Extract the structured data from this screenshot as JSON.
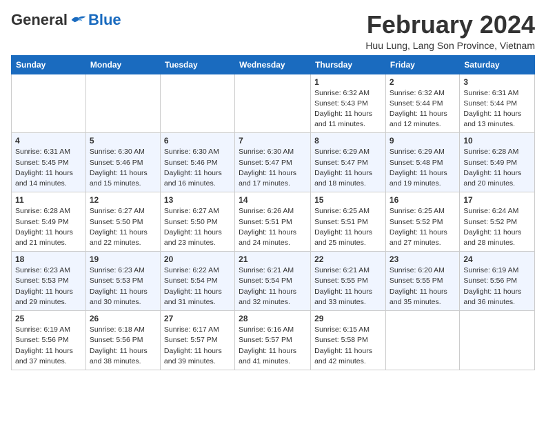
{
  "logo": {
    "general": "General",
    "blue": "Blue"
  },
  "title": "February 2024",
  "subtitle": "Huu Lung, Lang Son Province, Vietnam",
  "days_of_week": [
    "Sunday",
    "Monday",
    "Tuesday",
    "Wednesday",
    "Thursday",
    "Friday",
    "Saturday"
  ],
  "weeks": [
    [
      {
        "day": "",
        "info": ""
      },
      {
        "day": "",
        "info": ""
      },
      {
        "day": "",
        "info": ""
      },
      {
        "day": "",
        "info": ""
      },
      {
        "day": "1",
        "info": "Sunrise: 6:32 AM\nSunset: 5:43 PM\nDaylight: 11 hours and 11 minutes."
      },
      {
        "day": "2",
        "info": "Sunrise: 6:32 AM\nSunset: 5:44 PM\nDaylight: 11 hours and 12 minutes."
      },
      {
        "day": "3",
        "info": "Sunrise: 6:31 AM\nSunset: 5:44 PM\nDaylight: 11 hours and 13 minutes."
      }
    ],
    [
      {
        "day": "4",
        "info": "Sunrise: 6:31 AM\nSunset: 5:45 PM\nDaylight: 11 hours and 14 minutes."
      },
      {
        "day": "5",
        "info": "Sunrise: 6:30 AM\nSunset: 5:46 PM\nDaylight: 11 hours and 15 minutes."
      },
      {
        "day": "6",
        "info": "Sunrise: 6:30 AM\nSunset: 5:46 PM\nDaylight: 11 hours and 16 minutes."
      },
      {
        "day": "7",
        "info": "Sunrise: 6:30 AM\nSunset: 5:47 PM\nDaylight: 11 hours and 17 minutes."
      },
      {
        "day": "8",
        "info": "Sunrise: 6:29 AM\nSunset: 5:47 PM\nDaylight: 11 hours and 18 minutes."
      },
      {
        "day": "9",
        "info": "Sunrise: 6:29 AM\nSunset: 5:48 PM\nDaylight: 11 hours and 19 minutes."
      },
      {
        "day": "10",
        "info": "Sunrise: 6:28 AM\nSunset: 5:49 PM\nDaylight: 11 hours and 20 minutes."
      }
    ],
    [
      {
        "day": "11",
        "info": "Sunrise: 6:28 AM\nSunset: 5:49 PM\nDaylight: 11 hours and 21 minutes."
      },
      {
        "day": "12",
        "info": "Sunrise: 6:27 AM\nSunset: 5:50 PM\nDaylight: 11 hours and 22 minutes."
      },
      {
        "day": "13",
        "info": "Sunrise: 6:27 AM\nSunset: 5:50 PM\nDaylight: 11 hours and 23 minutes."
      },
      {
        "day": "14",
        "info": "Sunrise: 6:26 AM\nSunset: 5:51 PM\nDaylight: 11 hours and 24 minutes."
      },
      {
        "day": "15",
        "info": "Sunrise: 6:25 AM\nSunset: 5:51 PM\nDaylight: 11 hours and 25 minutes."
      },
      {
        "day": "16",
        "info": "Sunrise: 6:25 AM\nSunset: 5:52 PM\nDaylight: 11 hours and 27 minutes."
      },
      {
        "day": "17",
        "info": "Sunrise: 6:24 AM\nSunset: 5:52 PM\nDaylight: 11 hours and 28 minutes."
      }
    ],
    [
      {
        "day": "18",
        "info": "Sunrise: 6:23 AM\nSunset: 5:53 PM\nDaylight: 11 hours and 29 minutes."
      },
      {
        "day": "19",
        "info": "Sunrise: 6:23 AM\nSunset: 5:53 PM\nDaylight: 11 hours and 30 minutes."
      },
      {
        "day": "20",
        "info": "Sunrise: 6:22 AM\nSunset: 5:54 PM\nDaylight: 11 hours and 31 minutes."
      },
      {
        "day": "21",
        "info": "Sunrise: 6:21 AM\nSunset: 5:54 PM\nDaylight: 11 hours and 32 minutes."
      },
      {
        "day": "22",
        "info": "Sunrise: 6:21 AM\nSunset: 5:55 PM\nDaylight: 11 hours and 33 minutes."
      },
      {
        "day": "23",
        "info": "Sunrise: 6:20 AM\nSunset: 5:55 PM\nDaylight: 11 hours and 35 minutes."
      },
      {
        "day": "24",
        "info": "Sunrise: 6:19 AM\nSunset: 5:56 PM\nDaylight: 11 hours and 36 minutes."
      }
    ],
    [
      {
        "day": "25",
        "info": "Sunrise: 6:19 AM\nSunset: 5:56 PM\nDaylight: 11 hours and 37 minutes."
      },
      {
        "day": "26",
        "info": "Sunrise: 6:18 AM\nSunset: 5:56 PM\nDaylight: 11 hours and 38 minutes."
      },
      {
        "day": "27",
        "info": "Sunrise: 6:17 AM\nSunset: 5:57 PM\nDaylight: 11 hours and 39 minutes."
      },
      {
        "day": "28",
        "info": "Sunrise: 6:16 AM\nSunset: 5:57 PM\nDaylight: 11 hours and 41 minutes."
      },
      {
        "day": "29",
        "info": "Sunrise: 6:15 AM\nSunset: 5:58 PM\nDaylight: 11 hours and 42 minutes."
      },
      {
        "day": "",
        "info": ""
      },
      {
        "day": "",
        "info": ""
      }
    ]
  ]
}
